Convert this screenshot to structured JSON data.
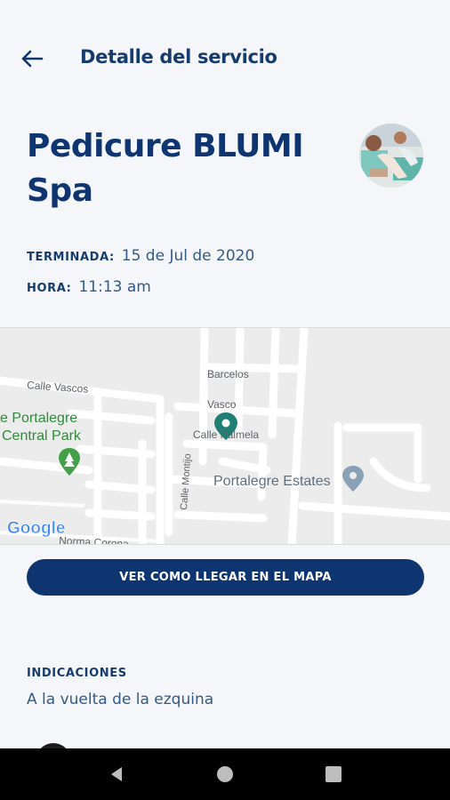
{
  "header": {
    "title": "Detalle del servicio",
    "back_icon": "arrow-left-icon"
  },
  "service": {
    "title": "Pedicure BLUMI Spa",
    "finished_label": "TERMINADA:",
    "finished_value": "15 de Jul de 2020",
    "time_label": "HORA:",
    "time_value": "11:13 am"
  },
  "map": {
    "labels": {
      "calle_vascos": "Calle Vascos",
      "barcelos": "Barcelos",
      "vasco": "Vasco",
      "calle_palmela": "Calle Palmela",
      "park_line1": "e Portalegre",
      "park_line2": "Central Park",
      "calle_montijo": "Calle Montijo",
      "portalegre_estates": "Portalegre Estates",
      "norma_corona": "Norma Corona",
      "google": "Google"
    },
    "colors": {
      "park": "#43a047",
      "pin": "#1e8074",
      "place": "#7a8fa3"
    }
  },
  "actions": {
    "map_button": "VER COMO LLEGAR EN EL MAPA"
  },
  "indications": {
    "label": "INDICACIONES",
    "value": "A la vuelta de la ezquina"
  },
  "navbar": {
    "back": "triangle-back-icon",
    "home": "circle-home-icon",
    "recents": "square-recents-icon"
  }
}
